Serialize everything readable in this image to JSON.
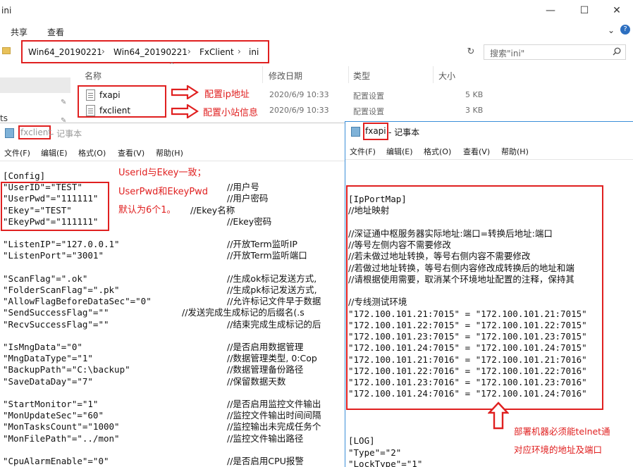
{
  "explorer": {
    "title": "ini",
    "window_buttons": {
      "minimize": "—",
      "maximize": "☐",
      "close": "✕"
    },
    "menu": {
      "share": "共享",
      "view": "查看"
    },
    "breadcrumb": [
      "Win64_20190221",
      "Win64_20190221",
      "FxClient",
      "ini"
    ],
    "search_placeholder": "搜索\"ini\"",
    "columns": {
      "name": "名称",
      "modified": "修改日期",
      "type": "类型",
      "size": "大小"
    },
    "left_pane_text": "ts",
    "files": [
      {
        "name": "fxapi",
        "modified": "2020/6/9 10:33",
        "type": "配置设置",
        "size": "5 KB"
      },
      {
        "name": "fxclient",
        "modified": "2020/6/9 10:33",
        "type": "配置设置",
        "size": "3 KB"
      }
    ],
    "annotations": {
      "fxapi": "配置ip地址",
      "fxclient": "配置小站信息"
    }
  },
  "notepad_left": {
    "file": "fxclient",
    "app": " - 记事本",
    "menu": [
      "文件(F)",
      "编辑(E)",
      "格式(O)",
      "查看(V)",
      "帮助(H)"
    ],
    "lines": [
      "[Config]",
      "\"UserID\"=\"TEST\"",
      "\"UserPwd\"=\"111111\"",
      "\"Ekey\"=\"TEST\"",
      "\"EkeyPwd\"=\"111111\"",
      "",
      "\"ListenIP\"=\"127.0.0.1\"",
      "\"ListenPort\"=\"3001\"",
      "",
      "\"ScanFlag\"=\".ok\"",
      "\"FolderScanFlag\"=\".pk\"",
      "\"AllowFlagBeforeDataSec\"=\"0\"",
      "\"SendSuccessFlag\"=\"\"",
      "\"RecvSuccessFlag\"=\"\"",
      "",
      "\"IsMngData\"=\"0\"",
      "\"MngDataType\"=\"1\"",
      "\"BackupPath\"=\"C:\\backup\"",
      "\"SaveDataDay\"=\"7\"",
      "",
      "\"StartMonitor\"=\"1\"",
      "\"MonUpdateSec\"=\"60\"",
      "\"MonTasksCount\"=\"1000\"",
      "\"MonFilePath\"=\"../mon\"",
      "",
      "\"CpuAlarmEnable\"=\"0\""
    ],
    "comments": [
      {
        "line": 1,
        "text": "//用户号"
      },
      {
        "line": 2,
        "text": "//用户密码"
      },
      {
        "line": 3,
        "text": "//Ekey名称"
      },
      {
        "line": 4,
        "text": "//Ekey密码"
      },
      {
        "line": 6,
        "text": "//开放Term监听IP"
      },
      {
        "line": 7,
        "text": "//开放Term监听端口"
      },
      {
        "line": 9,
        "text": "//生成ok标记发送方式,"
      },
      {
        "line": 10,
        "text": "//生成pk标记发送方式,"
      },
      {
        "line": 11,
        "text": "//允许标记文件早于数据"
      },
      {
        "line": 12,
        "text": "//发送完成生成标记的后缀名(.s"
      },
      {
        "line": 13,
        "text": "//结束完成生成标记的后"
      },
      {
        "line": 15,
        "text": "//是否启用数据管理"
      },
      {
        "line": 16,
        "text": "//数据管理类型, 0:Cop"
      },
      {
        "line": 17,
        "text": "//数据管理备份路径"
      },
      {
        "line": 18,
        "text": "//保留数据天数"
      },
      {
        "line": 20,
        "text": "//是否启用监控文件输出"
      },
      {
        "line": 21,
        "text": "//监控文件输出时间间隔"
      },
      {
        "line": 22,
        "text": "//监控输出未完成任务个"
      },
      {
        "line": 23,
        "text": "//监控文件输出路径"
      },
      {
        "line": 25,
        "text": "//是否启用CPU报警"
      }
    ],
    "annotation_lines": [
      "Userid与Ekey一致；",
      "UserPwd和EkeyPwd",
      "默认为6个1。"
    ]
  },
  "notepad_right": {
    "file": "fxapi",
    "app": " - 记事本",
    "menu": [
      "文件(F)",
      "编辑(E)",
      "格式(O)",
      "查看(V)",
      "帮助(H)"
    ],
    "lines": [
      "[IpPortMap]",
      "//地址映射",
      "",
      "//深证通中枢服务器实际地址:端口=转换后地址:端口",
      "//等号左侧内容不需要修改",
      "//若未做过地址转换，等号右侧内容不需要修改",
      "//若做过地址转换，等号右侧内容修改成转换后的地址和端",
      "//请根据使用需要，取消某个环境地址配置的注释，保持其",
      "",
      "//专线测试环境",
      "\"172.100.101.21:7015\" = \"172.100.101.21:7015\"",
      "\"172.100.101.22:7015\" = \"172.100.101.22:7015\"",
      "\"172.100.101.23:7015\" = \"172.100.101.23:7015\"",
      "\"172.100.101.24:7015\" = \"172.100.101.24:7015\"",
      "\"172.100.101.21:7016\" = \"172.100.101.21:7016\"",
      "\"172.100.101.22:7016\" = \"172.100.101.22:7016\"",
      "\"172.100.101.23:7016\" = \"172.100.101.23:7016\"",
      "\"172.100.101.24:7016\" = \"172.100.101.24:7016\"",
      "",
      "",
      "",
      "[LOG]",
      "\"Type\"=\"2\"",
      "\"LockType\"=\"1\""
    ],
    "annotation_lines": [
      "部署机器必须能telnet通",
      "对应环境的地址及端口"
    ]
  },
  "colors": {
    "annotation": "#e02020",
    "focus_border": "#3b8ed8"
  }
}
